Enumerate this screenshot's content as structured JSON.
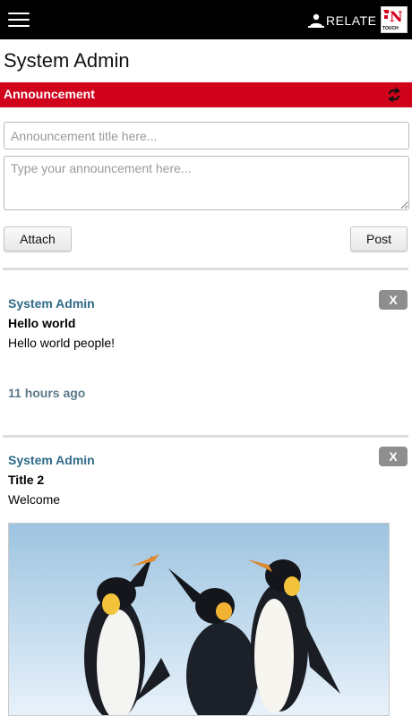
{
  "topbar": {
    "brand": "RELATE",
    "logo_text": "TOUCH"
  },
  "page": {
    "title": "System Admin"
  },
  "announcement": {
    "header": "Announcement",
    "title_placeholder": "Announcement title here...",
    "body_placeholder": "Type your announcement here...",
    "attach_label": "Attach",
    "post_label": "Post"
  },
  "posts": [
    {
      "author": "System Admin",
      "title": "Hello world",
      "body": "Hello world people!",
      "time": "11 hours ago",
      "delete_label": "X"
    },
    {
      "author": "System Admin",
      "title": "Title 2",
      "body": "Welcome",
      "delete_label": "X",
      "image": "penguins-photo"
    }
  ],
  "colors": {
    "topbar": "#000000",
    "accent": "#d0021b",
    "author": "#2e6a87",
    "timestamp": "#5c7a8a",
    "delete_button": "#8e8e8e"
  }
}
